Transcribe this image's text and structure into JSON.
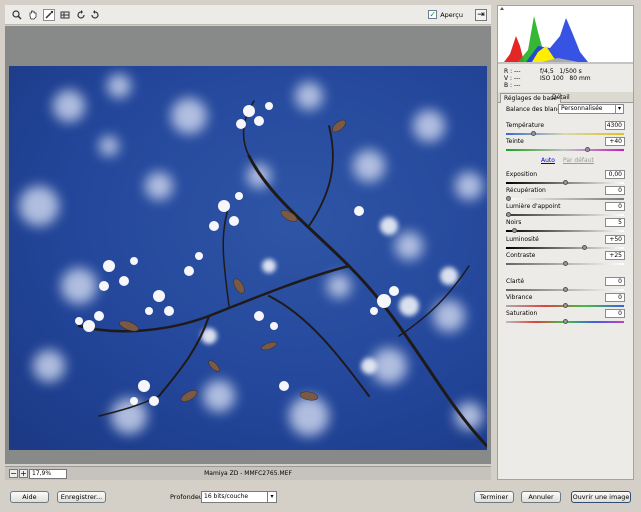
{
  "toolbar": {
    "tools": [
      "zoom-icon",
      "hand-icon",
      "white-balance-icon",
      "color-sampler-icon",
      "rotate-left-icon",
      "rotate-right-icon"
    ],
    "preview_label": "Aperçu",
    "preview_checked": true
  },
  "status": {
    "zoom": "17,9%",
    "filename": "Mamiya ZD  -  MMFC2765.MEF"
  },
  "info": {
    "r": "R :  ---",
    "g": "V :  ---",
    "b": "B :  ---",
    "aperture": "f/4,5",
    "shutter": "1/500 s",
    "iso": "ISO 100",
    "focal": "80 mm"
  },
  "panel": {
    "tab_basic": "Réglages de base",
    "tab_detail": "Détail",
    "wb_label": "Balance des blancs :",
    "wb_value": "Personnalisée",
    "auto_link": "Auto",
    "default_link": "Par défaut",
    "sliders": [
      {
        "label": "Température",
        "value": "4300",
        "pos": 0.22
      },
      {
        "label": "Teinte",
        "value": "+40",
        "pos": 0.7
      },
      {
        "label": "Exposition",
        "value": "0,00",
        "pos": 0.5
      },
      {
        "label": "Récupération",
        "value": "0",
        "pos": 0.0
      },
      {
        "label": "Lumière d'appoint",
        "value": "0",
        "pos": 0.0
      },
      {
        "label": "Noirs",
        "value": "5",
        "pos": 0.05
      },
      {
        "label": "Luminosité",
        "value": "+50",
        "pos": 0.67
      },
      {
        "label": "Contraste",
        "value": "+25",
        "pos": 0.5
      },
      {
        "label": "Clarté",
        "value": "0",
        "pos": 0.5
      },
      {
        "label": "Vibrance",
        "value": "0",
        "pos": 0.5
      },
      {
        "label": "Saturation",
        "value": "0",
        "pos": 0.5
      }
    ]
  },
  "bottom": {
    "help": "Aide",
    "save": "Enregistrer...",
    "depth_label": "Profondeur :",
    "depth_value": "16 bits/couche",
    "done": "Terminer",
    "cancel": "Annuler",
    "open": "Ouvrir une image"
  },
  "colors": {
    "accent": "#304c74",
    "panel_bg": "#ecebe7",
    "canvas_bg": "#888989"
  }
}
